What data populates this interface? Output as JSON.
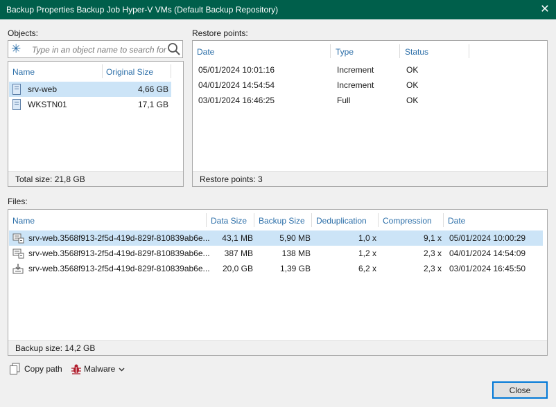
{
  "window": {
    "title": "Backup Properties Backup Job Hyper-V VMs (Default Backup Repository)"
  },
  "objects": {
    "label": "Objects:",
    "search_placeholder": "Type in an object name to search for",
    "columns": {
      "name": "Name",
      "size": "Original Size"
    },
    "rows": [
      {
        "name": "srv-web",
        "size": "4,66 GB",
        "selected": true
      },
      {
        "name": "WKSTN01",
        "size": "17,1 GB",
        "selected": false
      }
    ],
    "total": "Total size: 21,8 GB"
  },
  "restore_points": {
    "label": "Restore points:",
    "columns": {
      "date": "Date",
      "type": "Type",
      "status": "Status"
    },
    "rows": [
      {
        "date": "05/01/2024 10:01:16",
        "type": "Increment",
        "status": "OK"
      },
      {
        "date": "04/01/2024 14:54:54",
        "type": "Increment",
        "status": "OK"
      },
      {
        "date": "03/01/2024 16:46:25",
        "type": "Full",
        "status": "OK"
      }
    ],
    "count": "Restore points: 3"
  },
  "files": {
    "label": "Files:",
    "columns": {
      "name": "Name",
      "data_size": "Data Size",
      "backup_size": "Backup Size",
      "dedup": "Deduplication",
      "compression": "Compression",
      "date": "Date"
    },
    "rows": [
      {
        "name": "srv-web.3568f913-2f5d-419d-829f-810839ab6e...",
        "data_size": "43,1 MB",
        "backup_size": "5,90 MB",
        "dedup": "1,0 x",
        "compression": "9,1 x",
        "date": "05/01/2024 10:00:29",
        "icon": "incremental-backup-file-icon",
        "selected": true
      },
      {
        "name": "srv-web.3568f913-2f5d-419d-829f-810839ab6e...",
        "data_size": "387 MB",
        "backup_size": "138 MB",
        "dedup": "1,2 x",
        "compression": "2,3 x",
        "date": "04/01/2024 14:54:09",
        "icon": "incremental-backup-file-icon",
        "selected": false
      },
      {
        "name": "srv-web.3568f913-2f5d-419d-829f-810839ab6e...",
        "data_size": "20,0 GB",
        "backup_size": "1,39 GB",
        "dedup": "6,2 x",
        "compression": "2,3 x",
        "date": "03/01/2024 16:45:50",
        "icon": "full-backup-file-icon",
        "selected": false
      }
    ],
    "backup_size": "Backup size: 14,2 GB"
  },
  "toolbar": {
    "copy_path": "Copy path",
    "malware": "Malware"
  },
  "buttons": {
    "close": "Close"
  },
  "colors": {
    "titlebar": "#005f4b",
    "header_text": "#2b6ea8",
    "selection": "#cce4f7",
    "malware_icon": "#b01f2e"
  }
}
